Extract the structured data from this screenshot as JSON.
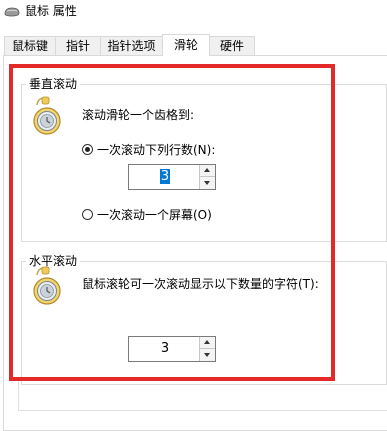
{
  "window": {
    "title": "鼠标 属性",
    "icon": "mouse-icon"
  },
  "tabs": [
    {
      "label": "鼠标键",
      "active": false
    },
    {
      "label": "指针",
      "active": false
    },
    {
      "label": "指针选项",
      "active": false
    },
    {
      "label": "滑轮",
      "active": true
    },
    {
      "label": "硬件",
      "active": false
    }
  ],
  "vertical": {
    "group_label": "垂直滚动",
    "icon": "mouse-wheel-icon",
    "description": "滚动滑轮一个齿格到:",
    "option_lines_label": "一次滚动下列行数(N):",
    "option_lines_selected": true,
    "lines_value": "3",
    "option_screen_label": "一次滚动一个屏幕(O)",
    "option_screen_selected": false
  },
  "horizontal": {
    "group_label": "水平滚动",
    "icon": "mouse-wheel-icon",
    "description": "鼠标滚轮可一次滚动显示以下数量的字符(T):",
    "chars_value": "3"
  },
  "colors": {
    "annotation": "#e32a2a",
    "selection": "#0078d7"
  }
}
